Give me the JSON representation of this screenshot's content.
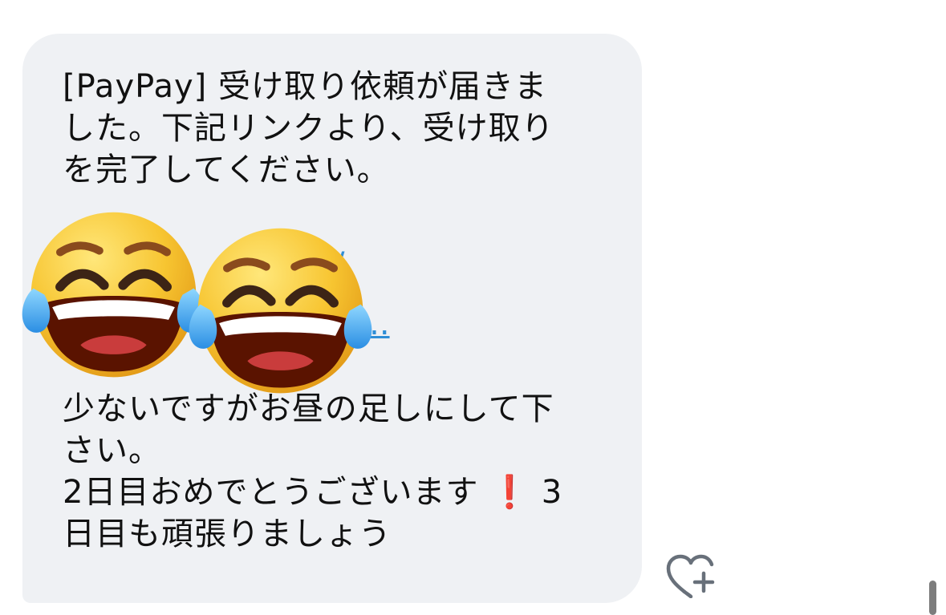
{
  "message": {
    "line1": "[PayPay] 受け取り依頼が届きま",
    "line2": "した。下記リンクより、受け取り",
    "line3": "を完了してください。",
    "link_fragment_1": "/",
    "link_fragment_2": "p...",
    "line4": "少ないですがお昼の足しにして下",
    "line5": "さい。",
    "line6_prefix": "2日目おめでとうございます",
    "line6_mark": "❗",
    "line6_suffix": "3",
    "line7": "日目も頑張りましょう"
  },
  "emojis": {
    "left": "face-with-tears-of-joy-icon",
    "right": "face-with-tears-of-joy-icon"
  },
  "actions": {
    "react_icon": "heart-plus-icon"
  },
  "colors": {
    "bubble_bg": "#eff1f4",
    "text": "#111111",
    "link": "#2f8ed6",
    "exclamation": "#e1262b",
    "emoji_face": "#f7c531"
  }
}
